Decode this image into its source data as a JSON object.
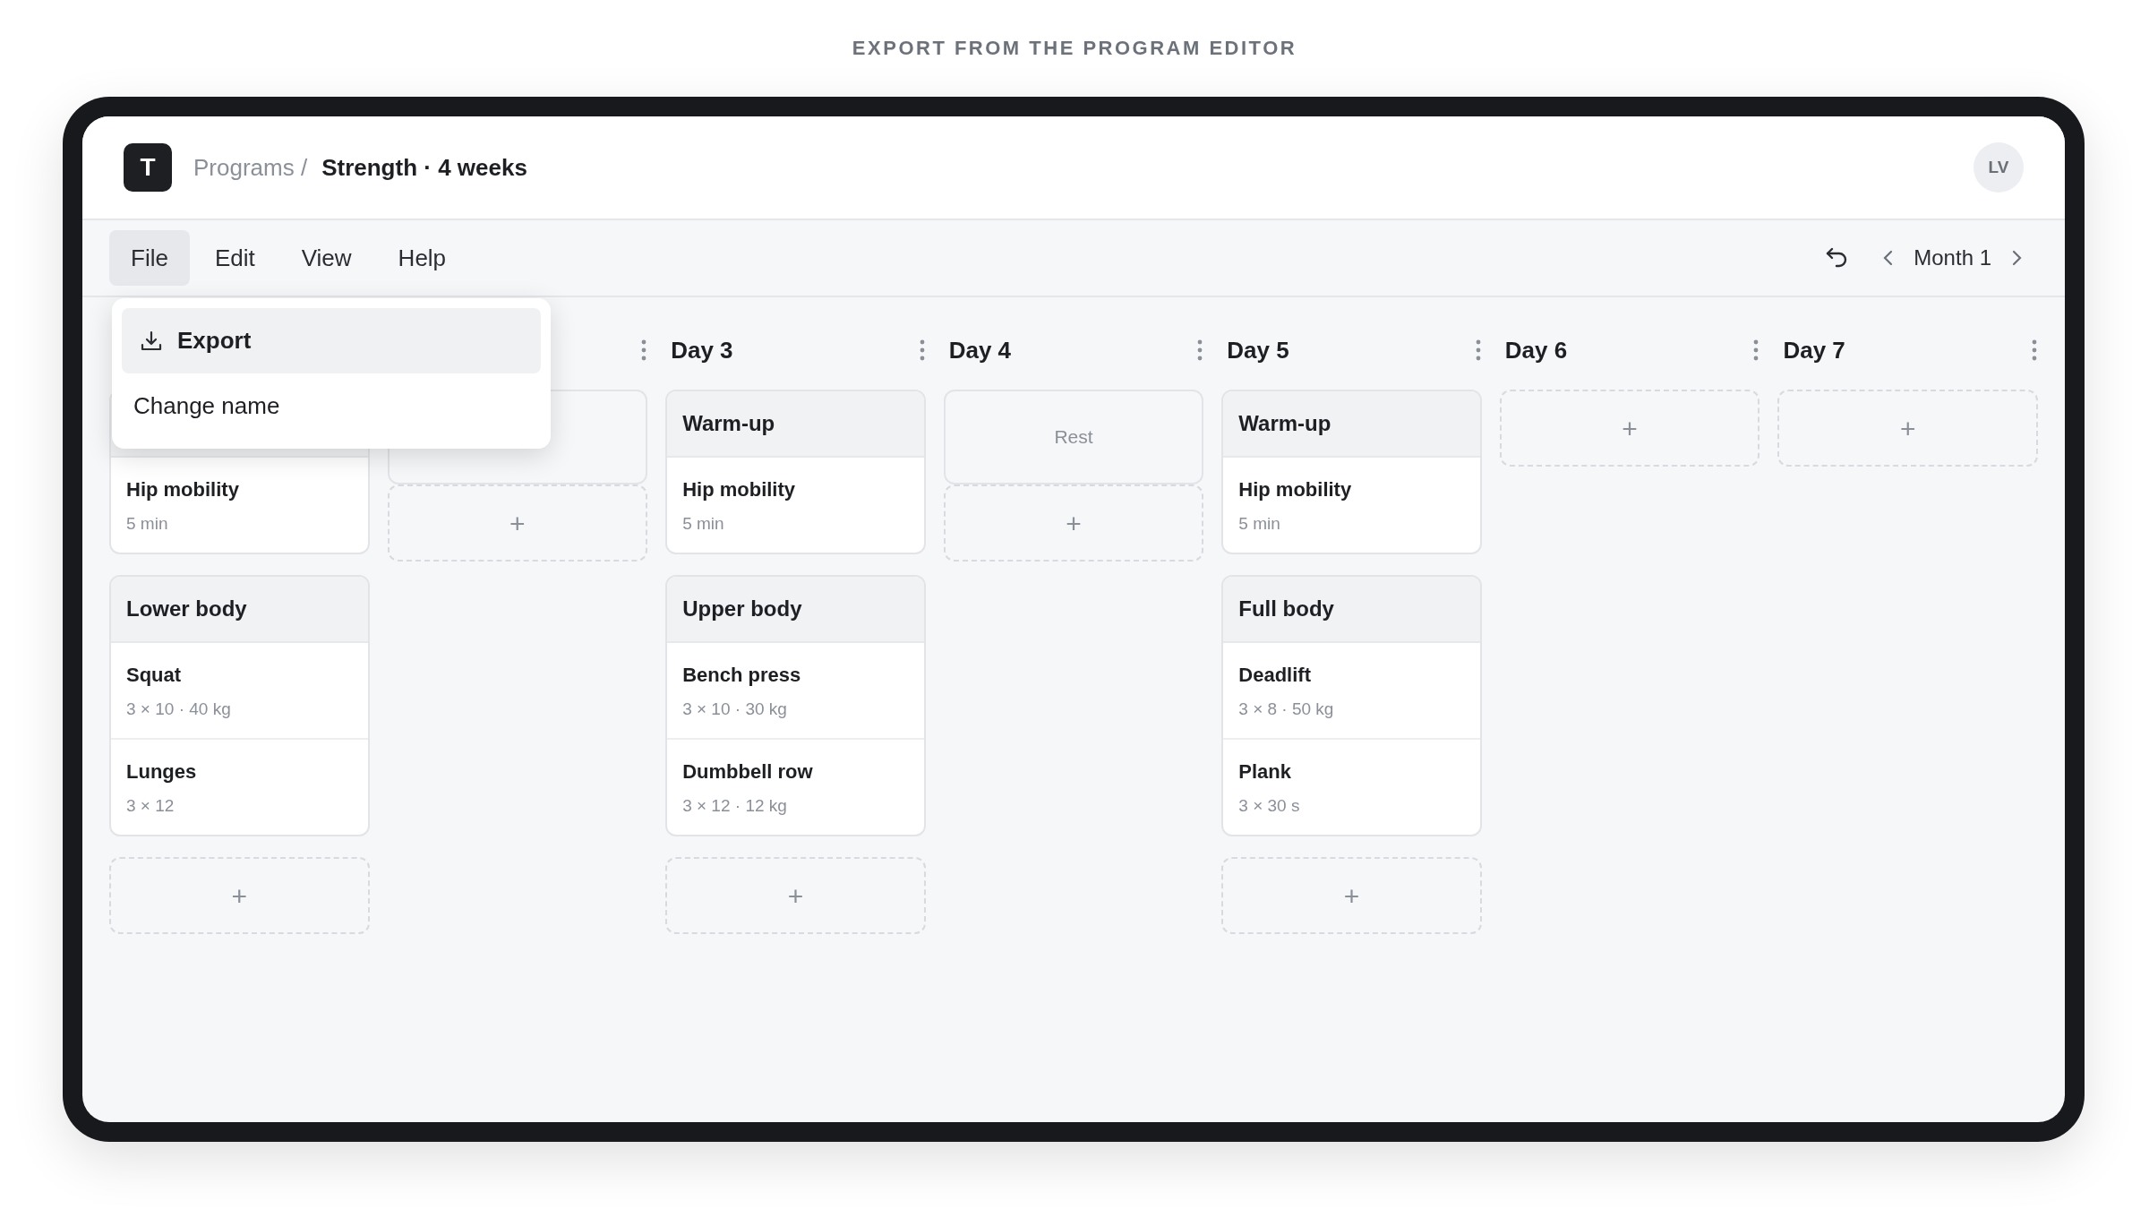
{
  "caption": "EXPORT FROM THE PROGRAM EDITOR",
  "app": {
    "logo": "T",
    "breadcrumb": {
      "parent": "Programs /",
      "current": "Strength · 4 weeks"
    },
    "avatar": "LV"
  },
  "menu": [
    {
      "label": "File",
      "selected": true
    },
    {
      "label": "Edit",
      "selected": false
    },
    {
      "label": "View",
      "selected": false
    },
    {
      "label": "Help",
      "selected": false
    }
  ],
  "file_menu": [
    {
      "label": "Export",
      "selected": true,
      "kind": "download"
    },
    {
      "label": "Change name",
      "selected": false,
      "kind": "plain"
    }
  ],
  "toolbar": {
    "period": "Month 1"
  },
  "days": [
    {
      "blocks": [
        {
          "kind": "session",
          "items": [
            {
              "name": "Hip mobility",
              "detail": "5 min"
            }
          ]
        },
        {
          "kind": "session",
          "title": "Lower body",
          "items": [
            {
              "name": "Squat",
              "detail": "3 × 10 · 40 kg"
            },
            {
              "name": "Lunges",
              "detail": "3 × 12"
            }
          ]
        }
      ],
      "add": "+"
    },
    {
      "more_icon": true,
      "blocks": [
        {
          "kind": "rest"
        }
      ],
      "add": "+"
    },
    {
      "title": "Day 3",
      "more_icon": true,
      "blocks": [
        {
          "kind": "session",
          "title": "Warm-up",
          "items": [
            {
              "name": "Hip mobility",
              "detail": "5 min"
            }
          ]
        },
        {
          "kind": "session",
          "title": "Upper body",
          "items": [
            {
              "name": "Bench press",
              "detail": "3 × 10 · 30 kg"
            },
            {
              "name": "Dumbbell row",
              "detail": "3 × 12 · 12 kg"
            }
          ]
        }
      ],
      "add": "+"
    },
    {
      "title": "Day 4",
      "more_icon": true,
      "blocks": [
        {
          "kind": "rest",
          "label": "Rest"
        }
      ],
      "add": "+"
    },
    {
      "title": "Day 5",
      "more_icon": true,
      "blocks": [
        {
          "kind": "session",
          "title": "Warm-up",
          "items": [
            {
              "name": "Hip mobility",
              "detail": "5 min"
            }
          ]
        },
        {
          "kind": "session",
          "title": "Full body",
          "items": [
            {
              "name": "Deadlift",
              "detail": "3 × 8 · 50 kg"
            },
            {
              "name": "Plank",
              "detail": "3 × 30 s"
            }
          ]
        }
      ],
      "add": "+"
    },
    {
      "title": "Day 6",
      "more_icon": true,
      "add": "+"
    },
    {
      "title": "Day 7",
      "more_icon": true,
      "add": "+"
    }
  ]
}
